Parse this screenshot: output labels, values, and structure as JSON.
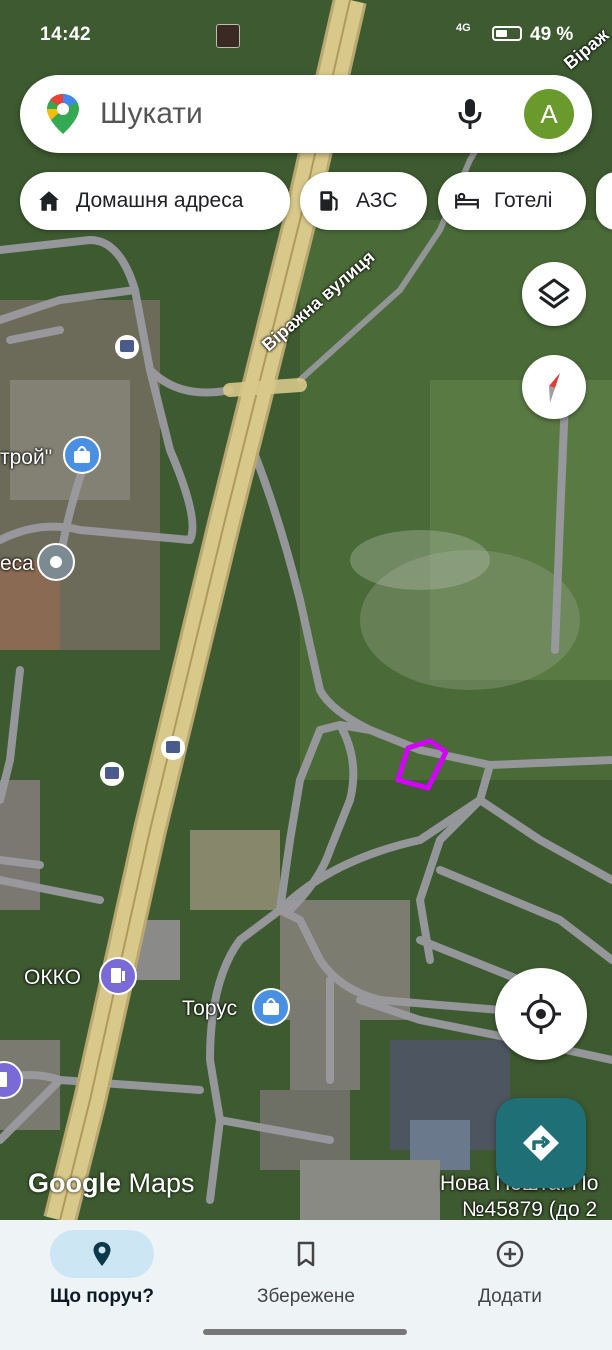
{
  "status_bar": {
    "time": "14:42",
    "network": "4G",
    "battery": "49 %",
    "battery_level": 0.49
  },
  "search": {
    "placeholder": "Шукати",
    "avatar_letter": "А"
  },
  "chips": [
    {
      "label": "Домашня адреса",
      "icon": "home-icon"
    },
    {
      "label": "АЗС",
      "icon": "gas-station-icon"
    },
    {
      "label": "Готелі",
      "icon": "hotel-icon"
    }
  ],
  "map_labels": {
    "street_main": "Віражна вулиця",
    "street_top": "Віраж",
    "poi_stroi": "трой\"",
    "poi_esa": "еса",
    "poi_okko": "ОККО",
    "poi_torus": "Торус",
    "poi_nova_line1": "Нова Пошта. По",
    "poi_nova_line2": "№45879 (до 2"
  },
  "watermark": {
    "google": "Google",
    "maps": "Maps"
  },
  "bottom_nav": [
    {
      "label": "Що поруч?",
      "icon": "location-pin-icon",
      "active": true
    },
    {
      "label": "Збережене",
      "icon": "bookmark-icon",
      "active": false
    },
    {
      "label": "Додати",
      "icon": "add-circle-icon",
      "active": false
    }
  ],
  "colors": {
    "accent": "#1f6f77",
    "nav_bg": "#eef3f6",
    "highlight": "#d400ff",
    "road_major": "#d8c88a"
  }
}
